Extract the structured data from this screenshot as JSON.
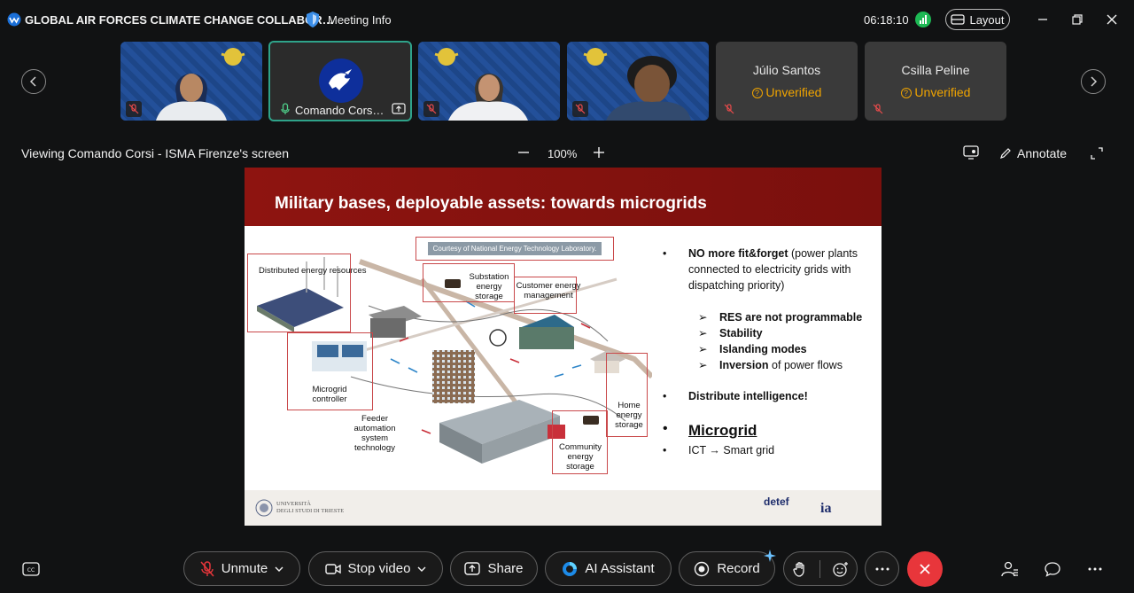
{
  "titlebar": {
    "app_title": "GLOBAL AIR FORCES CLIMATE CHANGE COLLABOR…",
    "meeting_info": "Meeting Info",
    "clock": "06:18:10",
    "layout_label": "Layout"
  },
  "participants": [
    {
      "kind": "video"
    },
    {
      "kind": "avatar",
      "label": "Comando Cors…"
    },
    {
      "kind": "video"
    },
    {
      "kind": "video"
    },
    {
      "kind": "name",
      "name": "Júlio Santos",
      "status": "Unverified"
    },
    {
      "kind": "name",
      "name": "Csilla Peline",
      "status": "Unverified"
    }
  ],
  "share_bar": {
    "viewing": "Viewing Comando Corsi - ISMA Firenze's screen",
    "zoom": "100%",
    "annotate": "Annotate"
  },
  "slide": {
    "title": "Military bases, deployable assets: towards microgrids",
    "courtesy": "Courtesy of National Energy Technology Laboratory.",
    "labels": {
      "distributed": "Distributed energy resources",
      "substation": "Substation energy storage",
      "customer": "Customer energy management",
      "controller": "Microgrid controller",
      "feeder": "Feeder automation system technology",
      "home": "Home energy storage",
      "community": "Community energy storage"
    },
    "bullets": {
      "b1_bold": "NO more fit&forget",
      "b1_rest": " (power plants connected to electricity grids with dispatching priority)",
      "sub1": "RES are not programmable",
      "sub2": "Stability",
      "sub3": "Islanding modes",
      "sub4_bold": "Inversion",
      "sub4_rest": " of power flows",
      "b2": "Distribute intelligence!",
      "b3": "Microgrid",
      "b4_a": "ICT",
      "b4_b": "Smart grid"
    },
    "footer": {
      "univ_line1": "UNIVERSITÀ",
      "univ_line2": "DEGLI STUDI DI TRIESTE",
      "detef": "detef",
      "ia": "ia"
    }
  },
  "toolbar": {
    "unmute": "Unmute",
    "stop_video": "Stop video",
    "share": "Share",
    "ai_assistant": "AI Assistant",
    "record": "Record"
  },
  "colors": {
    "leave_red": "#e8363b",
    "active_border": "#2fa38a",
    "unverified": "#f0a400",
    "slide_header": "#8e1410"
  }
}
